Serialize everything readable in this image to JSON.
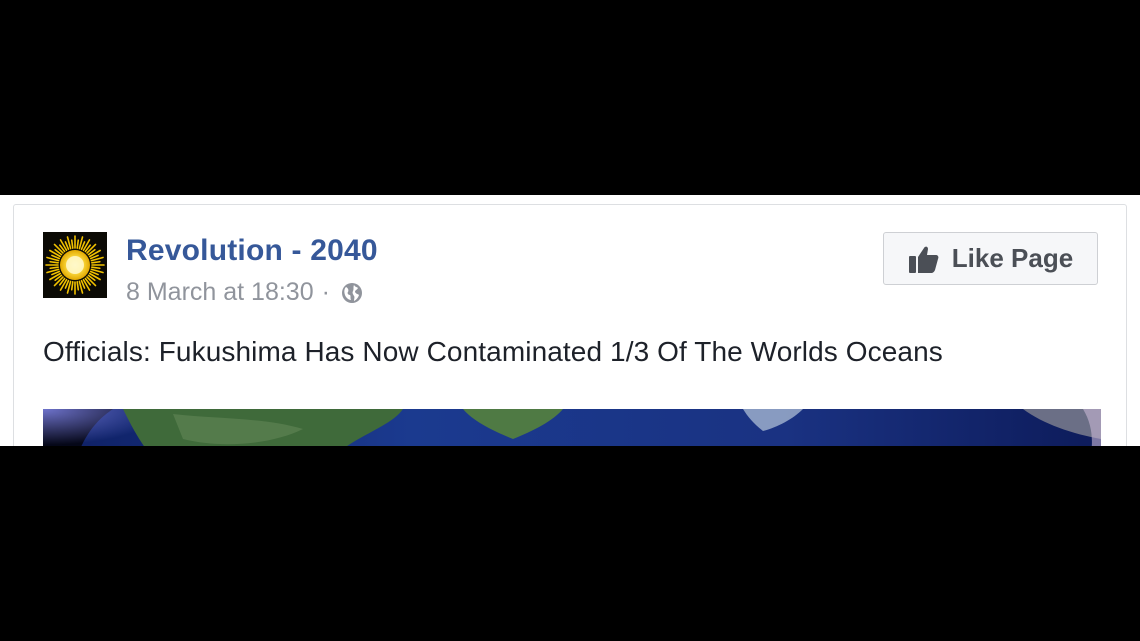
{
  "post": {
    "page_name": "Revolution - 2040",
    "timestamp": "8 March at 18:30",
    "separator": "·",
    "privacy_icon": "globe-icon",
    "text": "Officials: Fukushima Has Now Contaminated 1/3 Of The Worlds Oceans",
    "avatar_icon": "sun-logo"
  },
  "like_button": {
    "label": "Like Page",
    "icon": "thumbs-up-icon"
  },
  "colors": {
    "page_name": "#365899",
    "meta": "#90949c",
    "text": "#1d2129",
    "background_bars": "#000000"
  }
}
